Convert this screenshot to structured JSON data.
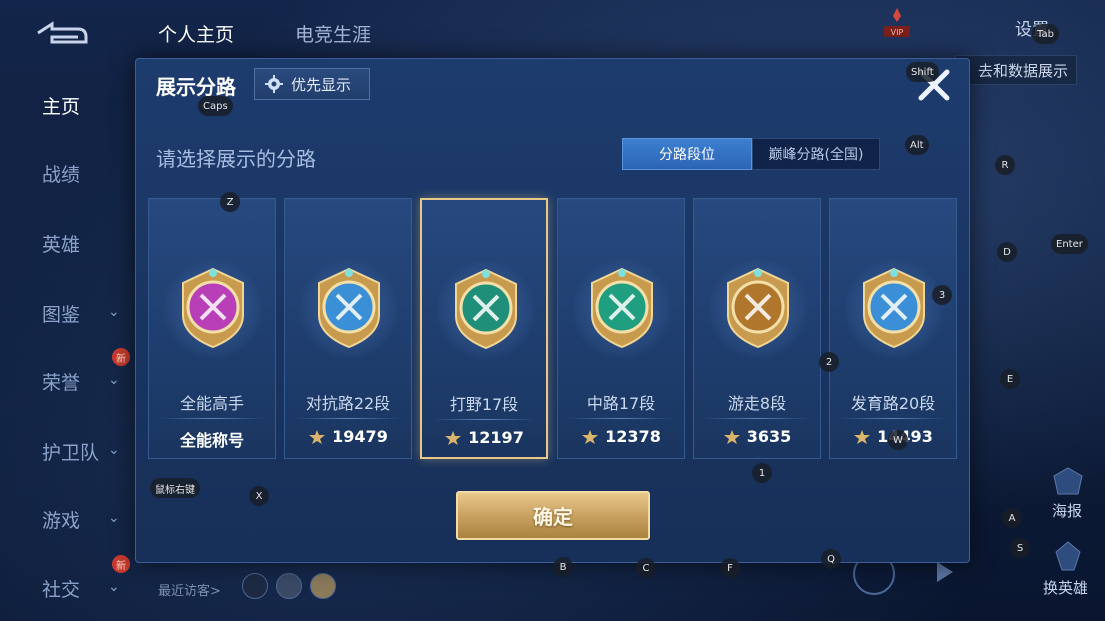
{
  "left_nav": {
    "items": [
      {
        "label": "主页",
        "active": true,
        "has_chevron": false,
        "new": false
      },
      {
        "label": "战绩",
        "active": false,
        "has_chevron": false,
        "new": false
      },
      {
        "label": "英雄",
        "active": false,
        "has_chevron": false,
        "new": false
      },
      {
        "label": "图鉴",
        "active": false,
        "has_chevron": true,
        "new": false
      },
      {
        "label": "荣誉",
        "active": false,
        "has_chevron": true,
        "new": true
      },
      {
        "label": "护卫队",
        "active": false,
        "has_chevron": true,
        "new": false
      },
      {
        "label": "游戏",
        "active": false,
        "has_chevron": true,
        "new": false
      },
      {
        "label": "社交",
        "active": false,
        "has_chevron": true,
        "new": true
      }
    ],
    "new_badge": "新"
  },
  "top_bar": {
    "tabs": [
      "个人主页",
      "电竞生涯"
    ],
    "settings": "设置",
    "sub_tab_right": "去和数据展示"
  },
  "dialog": {
    "title": "展示分路",
    "priority_button": "优先显示",
    "subtitle": "请选择展示的分路",
    "tabs": [
      {
        "label": "分路段位",
        "active": true
      },
      {
        "label": "巅峰分路(全国)",
        "active": false
      }
    ],
    "cards": [
      {
        "lane": "全能高手",
        "score": "全能称号",
        "has_rank_icon": false,
        "selected": false,
        "emblem_color": "#b83fb8"
      },
      {
        "lane": "对抗路22段",
        "score": "19479",
        "has_rank_icon": true,
        "selected": false,
        "emblem_color": "#3a8fd6"
      },
      {
        "lane": "打野17段",
        "score": "12197",
        "has_rank_icon": true,
        "selected": true,
        "emblem_color": "#1f8f7a"
      },
      {
        "lane": "中路17段",
        "score": "12378",
        "has_rank_icon": true,
        "selected": false,
        "emblem_color": "#1f9f7f"
      },
      {
        "lane": "游走8段",
        "score": "3635",
        "has_rank_icon": true,
        "selected": false,
        "emblem_color": "#b0762c"
      },
      {
        "lane": "发育路20段",
        "score": "14493",
        "has_rank_icon": true,
        "selected": false,
        "emblem_color": "#3a8fd6"
      }
    ],
    "confirm": "确定"
  },
  "bottom": {
    "visitors_label": "最近访客>"
  },
  "right_side": {
    "poster": "海报",
    "switch_hero": "换英雄"
  },
  "key_hints": [
    {
      "label": "Tab"
    },
    {
      "label": "Shift"
    },
    {
      "label": "Caps"
    },
    {
      "label": "Alt"
    },
    {
      "label": "R"
    },
    {
      "label": "Z"
    },
    {
      "label": "D"
    },
    {
      "label": "Enter"
    },
    {
      "label": "3"
    },
    {
      "label": "2"
    },
    {
      "label": "E"
    },
    {
      "label": "W"
    },
    {
      "label": "1"
    },
    {
      "label": "鼠标右键"
    },
    {
      "label": "X"
    },
    {
      "label": "A"
    },
    {
      "label": "S"
    },
    {
      "label": "B"
    },
    {
      "label": "C"
    },
    {
      "label": "F"
    },
    {
      "label": "Q"
    }
  ],
  "colors": {
    "accent_blue": "#3d7fd1",
    "gold": "#e8c886",
    "dialog_bg": "#1d3c6e"
  }
}
